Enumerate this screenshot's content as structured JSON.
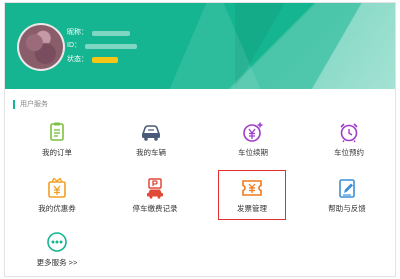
{
  "header": {
    "nickname_label": "昵称：",
    "id_label": "ID：",
    "status_label": "状态："
  },
  "section": {
    "title": "用户服务"
  },
  "services": [
    {
      "label": "我的订单",
      "icon": "clipboard-icon",
      "color": "#7cc13e"
    },
    {
      "label": "我的车辆",
      "icon": "car-icon",
      "color": "#4a5a7a"
    },
    {
      "label": "车位续期",
      "icon": "yen-plus-icon",
      "color": "#a03cc8"
    },
    {
      "label": "车位预约",
      "icon": "alarm-clock-icon",
      "color": "#a03cc8"
    },
    {
      "label": "我的优惠券",
      "icon": "coupon-icon",
      "color": "#f0a020"
    },
    {
      "label": "停车缴费记录",
      "icon": "parking-fee-icon",
      "color": "#e04838"
    },
    {
      "label": "发票管理",
      "icon": "invoice-ticket-icon",
      "color": "#f07a20"
    },
    {
      "label": "帮助与反馈",
      "icon": "edit-note-icon",
      "color": "#3b8fd8"
    },
    {
      "label": "更多服务 >>",
      "icon": "more-dots-icon",
      "color": "#16b591"
    }
  ]
}
